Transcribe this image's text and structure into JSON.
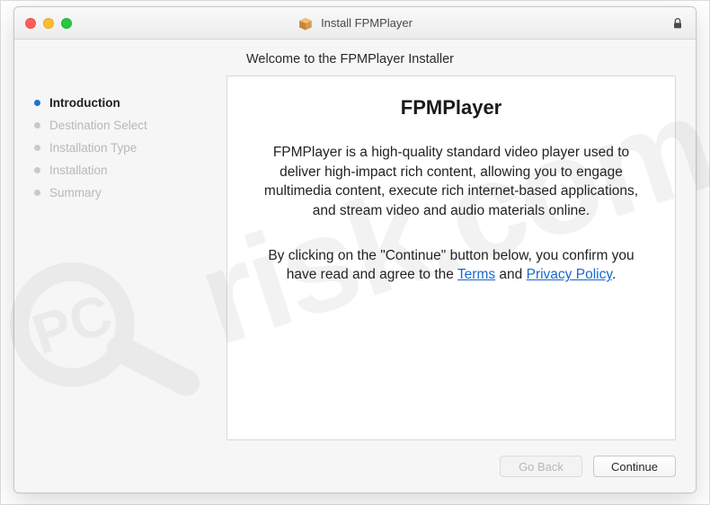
{
  "window": {
    "title": "Install FPMPlayer"
  },
  "header": {
    "welcome": "Welcome to the FPMPlayer Installer"
  },
  "sidebar": {
    "items": [
      {
        "label": "Introduction",
        "active": true
      },
      {
        "label": "Destination Select",
        "active": false
      },
      {
        "label": "Installation Type",
        "active": false
      },
      {
        "label": "Installation",
        "active": false
      },
      {
        "label": "Summary",
        "active": false
      }
    ]
  },
  "content": {
    "title": "FPMPlayer",
    "description": "FPMPlayer is a high-quality standard video player used to deliver high-impact rich content, allowing you to engage multimedia content, execute rich internet-based applications, and stream video and audio materials online.",
    "agree_prefix": "By clicking on the \"Continue\" button below, you confirm you have read and agree to the ",
    "terms_label": "Terms",
    "agree_middle": " and ",
    "privacy_label": "Privacy Policy",
    "agree_suffix": "."
  },
  "buttons": {
    "go_back": "Go Back",
    "continue": "Continue"
  },
  "watermark": {
    "text": "risk.com"
  }
}
